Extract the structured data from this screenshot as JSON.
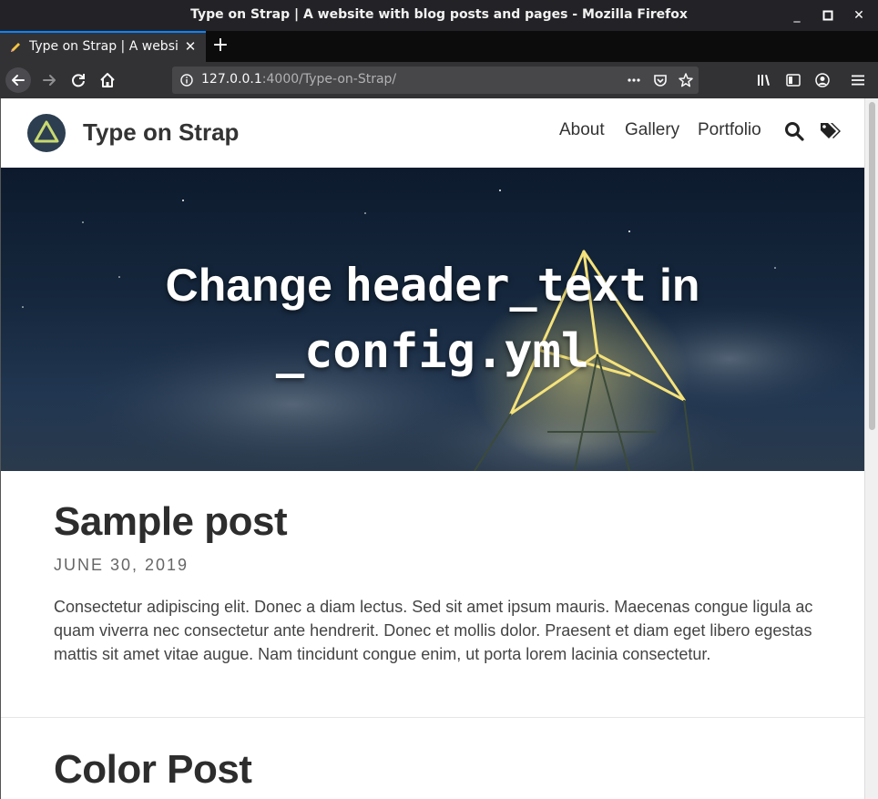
{
  "window": {
    "title": "Type on Strap | A website with blog posts and pages - Mozilla Firefox",
    "minimize": "_",
    "maximize": "□",
    "close": "✕"
  },
  "tab": {
    "label": "Type on Strap | A website with blog posts and pages",
    "close": "✕",
    "new_tab": "+"
  },
  "urlbar": {
    "host": "127.0.0.1",
    "path": ":4000/Type-on-Strap/"
  },
  "site": {
    "title": "Type on Strap",
    "nav": [
      "About",
      "Gallery",
      "Portfolio"
    ],
    "hero": {
      "line1_word": "Change",
      "line1_code": "header_text",
      "line1_tail": "in",
      "line2": "_config.yml"
    }
  },
  "posts": [
    {
      "title": "Sample post",
      "date": "JUNE 30, 2019",
      "excerpt": "Consectetur adipiscing elit. Donec a diam lectus. Sed sit amet ipsum mauris. Maecenas congue ligula ac quam viverra nec consectetur ante hendrerit. Donec et mollis dolor. Praesent et diam eget libero egestas mattis sit amet vitae augue. Nam tincidunt congue enim, ut porta lorem lacinia consectetur."
    },
    {
      "title": "Color Post"
    }
  ],
  "icons": {
    "favicon": "pencil-icon",
    "back": "arrow-left-icon",
    "forward": "arrow-right-icon",
    "reload": "reload-icon",
    "home": "home-icon",
    "info": "info-icon",
    "more": "ellipsis-icon",
    "pocket": "pocket-icon",
    "bookmark": "star-icon",
    "library": "library-icon",
    "sidebar": "sidebar-icon",
    "account": "account-icon",
    "menu": "hamburger-icon",
    "search": "search-icon",
    "tags": "tags-icon"
  },
  "colors": {
    "tab_accent": "#0a84ff",
    "avatar_bg": "#2c3e50",
    "avatar_triangle": "#c8d96f",
    "hero_glow": "#f5e27a"
  }
}
